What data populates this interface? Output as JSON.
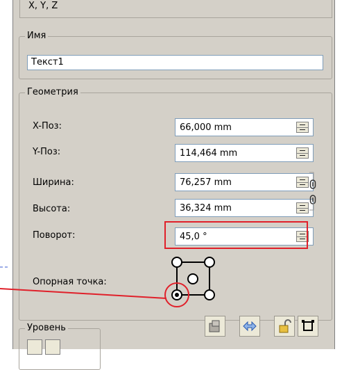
{
  "header": {
    "xyz_label": "X, Y, Z"
  },
  "name_group": {
    "title": "Имя",
    "value": "Текст1"
  },
  "geometry": {
    "title": "Геометрия",
    "rows": [
      {
        "label": "X-Поз:",
        "value": "66,000 mm"
      },
      {
        "label": "Y-Поз:",
        "value": "114,464 mm"
      },
      {
        "label": "Ширина:",
        "value": "76,257 mm"
      },
      {
        "label": "Высота:",
        "value": "36,324 mm"
      },
      {
        "label": "Поворот:",
        "value": "45,0 °"
      }
    ],
    "anchor_label": "Опорная точка:"
  },
  "level_group": {
    "title": "Уровень"
  },
  "colors": {
    "highlight": "#e0202a",
    "panel": "#d4d0c8",
    "input_border": "#7f9db9"
  },
  "icons": [
    "chain-link-icon",
    "anchor-point-icon",
    "lock-icon",
    "flip-icon",
    "frame-icon",
    "layer-icon"
  ]
}
